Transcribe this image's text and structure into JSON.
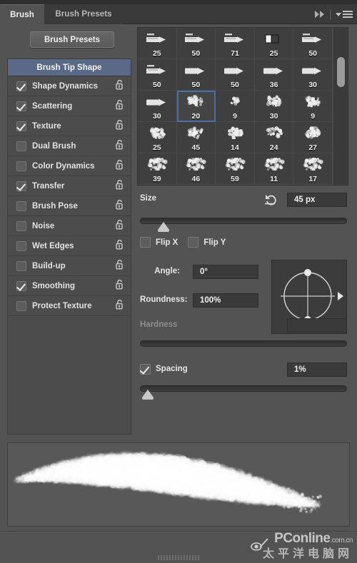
{
  "window": {
    "title": "Brush"
  },
  "tabs": [
    {
      "label": "Brush",
      "active": true
    },
    {
      "label": "Brush Presets",
      "active": false
    }
  ],
  "header_icons": {
    "collapse": "double-chevron-right-icon",
    "panel_menu": "panel-menu-icon"
  },
  "toolbar": {
    "brush_presets_label": "Brush Presets"
  },
  "options_panel": {
    "header": "Brush Tip Shape",
    "items": [
      {
        "label": "Shape Dynamics",
        "checked": true,
        "locked": false,
        "separator": false
      },
      {
        "label": "Scattering",
        "checked": true,
        "locked": false,
        "separator": false
      },
      {
        "label": "Texture",
        "checked": true,
        "locked": false,
        "separator": false
      },
      {
        "label": "Dual Brush",
        "checked": false,
        "locked": false,
        "separator": false
      },
      {
        "label": "Color Dynamics",
        "checked": false,
        "locked": false,
        "separator": false
      },
      {
        "label": "Transfer",
        "checked": true,
        "locked": false,
        "separator": false
      },
      {
        "label": "Brush Pose",
        "checked": false,
        "locked": false,
        "separator": true
      },
      {
        "label": "Noise",
        "checked": false,
        "locked": false,
        "separator": false
      },
      {
        "label": "Wet Edges",
        "checked": false,
        "locked": false,
        "separator": false
      },
      {
        "label": "Build-up",
        "checked": false,
        "locked": false,
        "separator": false
      },
      {
        "label": "Smoothing",
        "checked": true,
        "locked": false,
        "separator": false
      },
      {
        "label": "Protect Texture",
        "checked": false,
        "locked": false,
        "separator": false
      }
    ]
  },
  "brush_grid": {
    "selected_index": 11,
    "scroll_position": "near-top",
    "cells": [
      {
        "size": "25",
        "kind": "flat-chisel"
      },
      {
        "size": "50",
        "kind": "flat-chisel"
      },
      {
        "size": "71",
        "kind": "flat-chisel"
      },
      {
        "size": "25",
        "kind": "square-block"
      },
      {
        "size": "50",
        "kind": "flat-chisel"
      },
      {
        "size": "50",
        "kind": "flat-chisel"
      },
      {
        "size": "50",
        "kind": "round-chisel"
      },
      {
        "size": "50",
        "kind": "round-chisel"
      },
      {
        "size": "36",
        "kind": "round-chisel"
      },
      {
        "size": "30",
        "kind": "round-chisel"
      },
      {
        "size": "30",
        "kind": "round-chisel"
      },
      {
        "size": "20",
        "kind": "splatter-soft"
      },
      {
        "size": "9",
        "kind": "splatter-tiny"
      },
      {
        "size": "30",
        "kind": "splatter-dense"
      },
      {
        "size": "9",
        "kind": "splatter-spray"
      },
      {
        "size": "25",
        "kind": "splatter-fine"
      },
      {
        "size": "45",
        "kind": "splatter-cloud"
      },
      {
        "size": "14",
        "kind": "splatter-rough"
      },
      {
        "size": "24",
        "kind": "splatter-small"
      },
      {
        "size": "27",
        "kind": "splatter-chunk"
      },
      {
        "size": "39",
        "kind": "splatter-wide"
      },
      {
        "size": "46",
        "kind": "splatter-wide"
      },
      {
        "size": "59",
        "kind": "splatter-wide"
      },
      {
        "size": "11",
        "kind": "splatter-wide"
      },
      {
        "size": "17",
        "kind": "splatter-wide"
      }
    ]
  },
  "settings": {
    "size": {
      "label": "Size",
      "value": "45 px",
      "slider_percent": 9,
      "reset_icon": "reset-arrow-icon"
    },
    "flip_x": {
      "label": "Flip X",
      "checked": false
    },
    "flip_y": {
      "label": "Flip Y",
      "checked": false
    },
    "angle": {
      "label": "Angle:",
      "value": "0°"
    },
    "roundness": {
      "label": "Roundness:",
      "value": "100%"
    },
    "hardness": {
      "label": "Hardness",
      "value": "",
      "disabled": true,
      "slider_percent": 0
    },
    "spacing": {
      "label": "Spacing",
      "checked": true,
      "value": "1%",
      "slider_percent": 1
    },
    "angle_control": {
      "name": "angle-roundness-control"
    }
  },
  "preview": {
    "name": "brush-stroke-preview"
  },
  "bottom_bar": {
    "toggle_icon": "brush-preview-toggle-icon",
    "resize_grip": "resize-grip"
  },
  "watermark": {
    "line1": "PConline",
    "line1_suffix": ".com.cn",
    "line2": "太平洋电脑网"
  }
}
